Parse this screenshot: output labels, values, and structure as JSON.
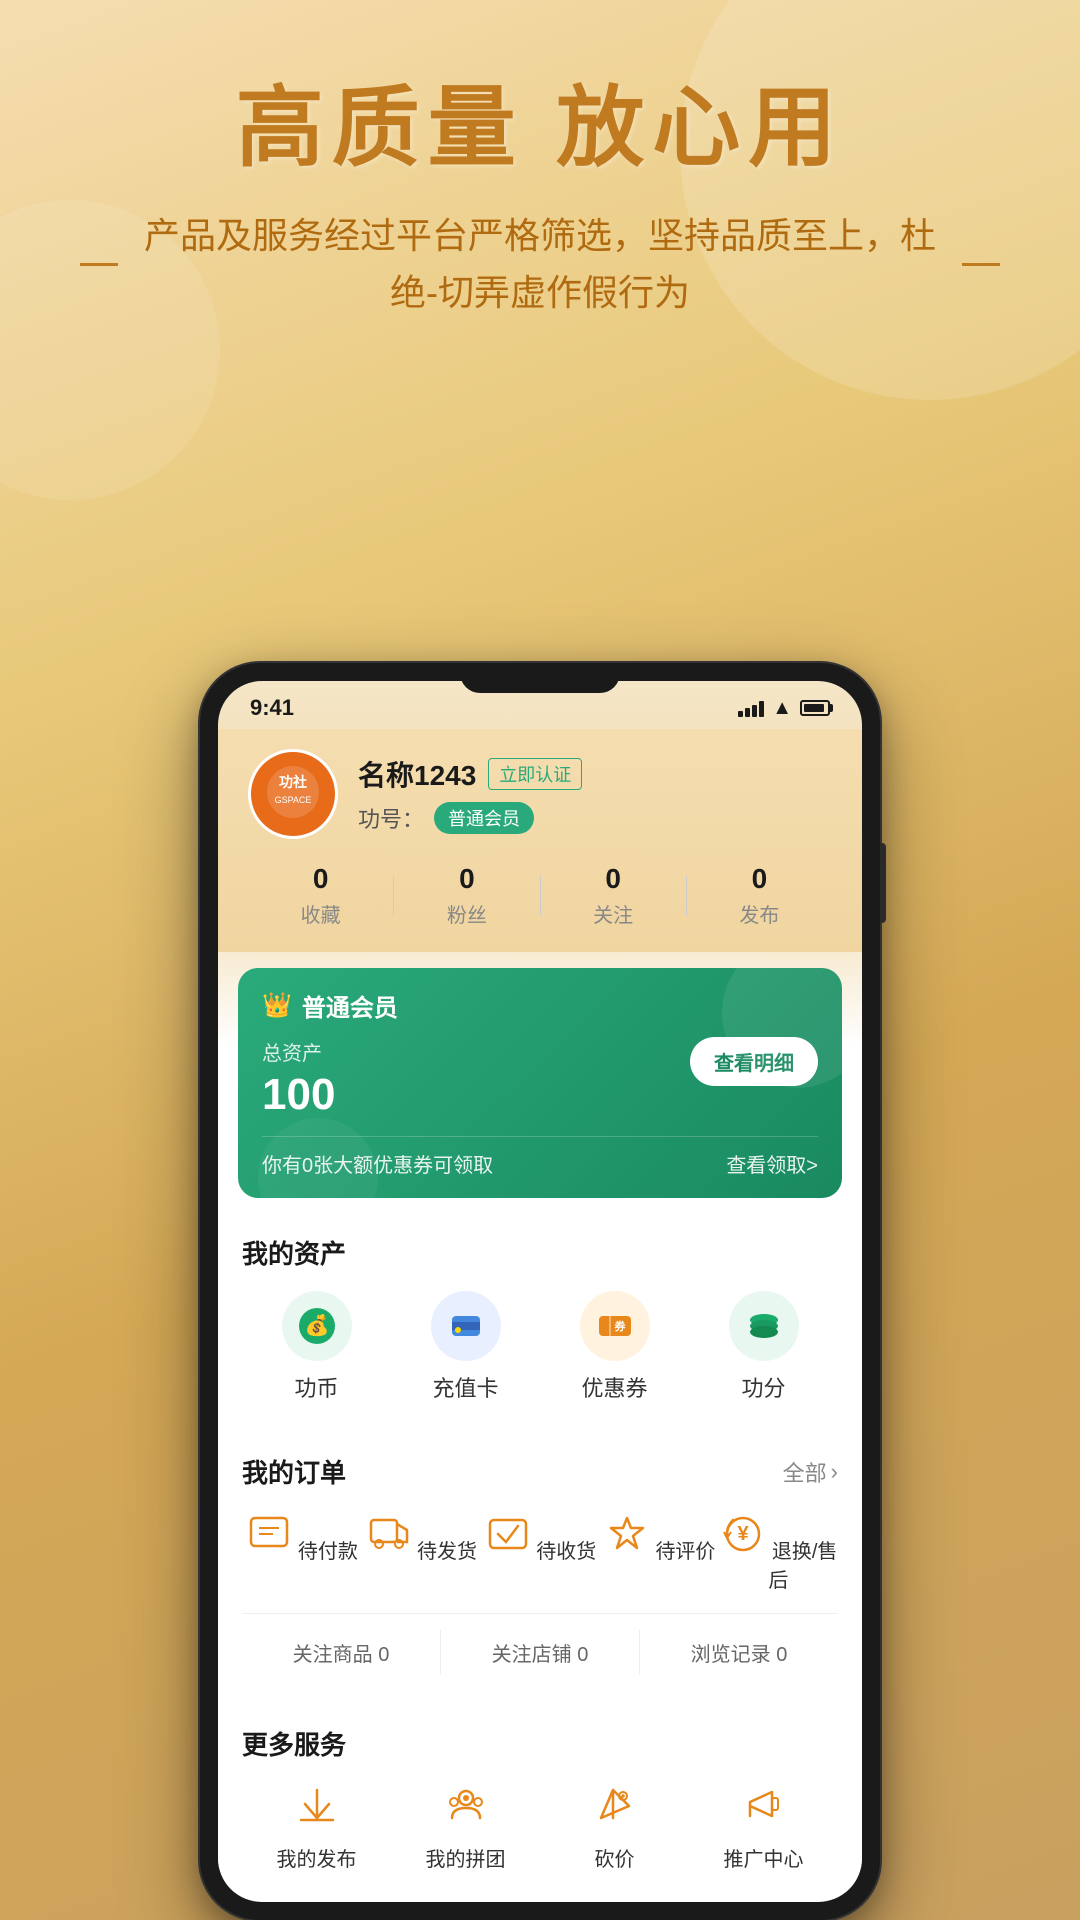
{
  "app": {
    "title": "高质量 放心用",
    "subtitle": "产品及服务经过平台严格筛选，坚持品质至上，杜绝-切弄虚作假行为"
  },
  "status_bar": {
    "time": "9:41",
    "signal": 4,
    "wifi": true,
    "battery": 90
  },
  "profile": {
    "name": "名称1243",
    "verify_label": "立即认证",
    "gong_label": "功号：",
    "member_level": "普通会员",
    "stats": {
      "collect": {
        "value": "0",
        "label": "收藏"
      },
      "fans": {
        "value": "0",
        "label": "粉丝"
      },
      "follow": {
        "value": "0",
        "label": "关注"
      },
      "publish": {
        "value": "0",
        "label": "发布"
      }
    }
  },
  "membership_card": {
    "title": "普通会员",
    "asset_label": "总资产",
    "asset_value": "100",
    "detail_btn": "查看明细",
    "coupon_text": "你有0张大额优惠券可领取",
    "coupon_link": "查看领取>"
  },
  "my_assets": {
    "title": "我的资产",
    "items": [
      {
        "icon": "💰",
        "label": "功币",
        "color": "#1aaa6a"
      },
      {
        "icon": "💳",
        "label": "充值卡",
        "color": "#4499dd"
      },
      {
        "icon": "🎫",
        "label": "优惠券",
        "color": "#e8871a"
      },
      {
        "icon": "🪙",
        "label": "功分",
        "color": "#1aaa6a"
      }
    ]
  },
  "my_orders": {
    "title": "我的订单",
    "all_label": "全部",
    "items": [
      {
        "icon": "💼",
        "label": "待付款"
      },
      {
        "icon": "📦",
        "label": "待发货"
      },
      {
        "icon": "🚚",
        "label": "待收货"
      },
      {
        "icon": "⭐",
        "label": "待评价"
      },
      {
        "icon": "🔄",
        "label": "退换/售后"
      }
    ],
    "footer_links": [
      {
        "text": "关注商品 0"
      },
      {
        "text": "关注店铺 0"
      },
      {
        "text": "浏览记录 0"
      }
    ]
  },
  "more_services": {
    "title": "更多服务",
    "items": [
      {
        "label": "我的发布"
      },
      {
        "label": "我的拼团"
      },
      {
        "label": "砍价"
      },
      {
        "label": "推广中心"
      }
    ]
  }
}
